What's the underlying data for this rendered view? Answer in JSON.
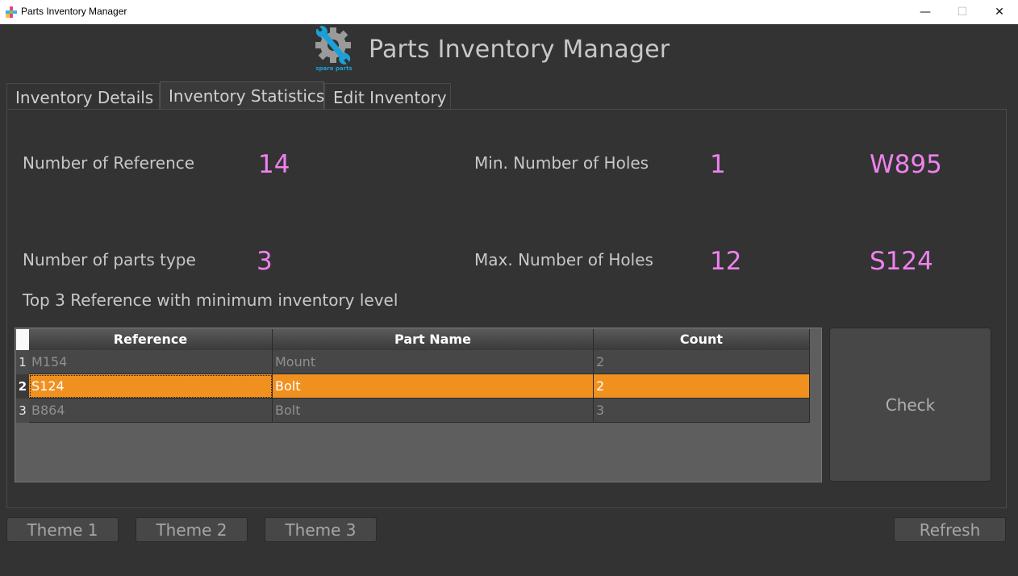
{
  "window": {
    "title": "Parts Inventory Manager",
    "minimize": "—",
    "maximize": "☐",
    "close": "✕"
  },
  "header": {
    "title": "Parts Inventory Manager",
    "logo_caption": "spare parts"
  },
  "tabs": [
    {
      "label": "Inventory Details"
    },
    {
      "label": "Inventory Statistics"
    },
    {
      "label": "Edit Inventory"
    }
  ],
  "active_tab": "Inventory Statistics",
  "stats": {
    "num_reference_label": "Number of Reference",
    "num_reference_value": "14",
    "num_parts_type_label": "Number of parts type",
    "num_parts_type_value": "3",
    "min_holes_label": "Min. Number of Holes",
    "min_holes_value": "1",
    "min_holes_ref": "W895",
    "max_holes_label": "Max. Number of Holes",
    "max_holes_value": "12",
    "max_holes_ref": "S124"
  },
  "top3": {
    "title": "Top 3 Reference with minimum inventory level",
    "columns": [
      "Reference",
      "Part Name",
      "Count"
    ],
    "rows": [
      {
        "num": "1",
        "cells": [
          "M154",
          "Mount",
          "2"
        ]
      },
      {
        "num": "2",
        "cells": [
          "S124",
          "Bolt",
          "2"
        ]
      },
      {
        "num": "3",
        "cells": [
          "B864",
          "Bolt",
          "3"
        ]
      }
    ],
    "selected_row": 2
  },
  "buttons": {
    "check": "Check",
    "theme1": "Theme 1",
    "theme2": "Theme 2",
    "theme3": "Theme 3",
    "refresh": "Refresh"
  },
  "colors": {
    "background": "#333333",
    "accent_value": "#ee82ee",
    "selection": "#f0901f",
    "logo_blue": "#1ba1d8"
  }
}
